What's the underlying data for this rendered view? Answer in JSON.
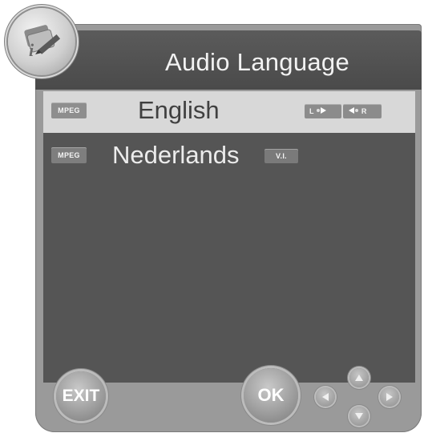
{
  "header": {
    "title": "Audio Language",
    "icon": "info-pencil-icon"
  },
  "tracks": [
    {
      "codec": "MPEG",
      "language": "English",
      "selected": true,
      "channel_left": "L",
      "channel_right": "R"
    },
    {
      "codec": "MPEG",
      "language": "Nederlands",
      "selected": false,
      "tag": "V.I."
    }
  ],
  "footer": {
    "exit_label": "EXIT",
    "ok_label": "OK"
  },
  "colors": {
    "panel": "#9a9a9a",
    "titlebar": "#4f4f4f",
    "list": "#555555",
    "selected_row": "#d8d8d8"
  }
}
